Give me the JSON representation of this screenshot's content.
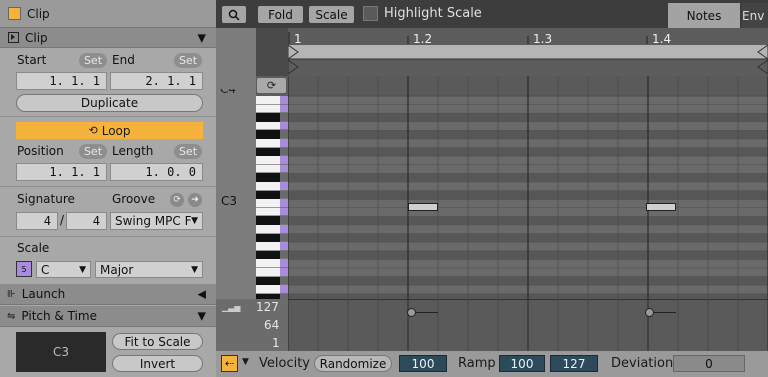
{
  "clip_panel": {
    "header_title": "Clip",
    "section_title": "Clip",
    "start_label": "Start",
    "end_label": "End",
    "set_label": "Set",
    "start_value": "1.   1.   1",
    "end_value": "2.   1.   1",
    "duplicate_label": "Duplicate",
    "loop_label": "Loop",
    "position_label": "Position",
    "length_label": "Length",
    "position_value": "1.   1.   1",
    "length_value": "1.   0.   0",
    "signature_label": "Signature",
    "groove_label": "Groove",
    "sig_numerator": "4",
    "sig_slash": "/",
    "sig_denominator": "4",
    "groove_value": "Swing MPC F",
    "scale_label": "Scale",
    "scale_root": "C",
    "scale_mode": "Major",
    "launch_label": "Launch",
    "pitch_time_label": "Pitch & Time",
    "pitch_display": "C3",
    "fit_to_scale_label": "Fit to Scale",
    "invert_label": "Invert"
  },
  "toolbar": {
    "fold_label": "Fold",
    "scale_label": "Scale",
    "highlight_scale_label": "Highlight Scale",
    "notes_tab": "Notes",
    "env_tab": "Env"
  },
  "ruler": {
    "markers": [
      "1",
      "1.2",
      "1.3",
      "1.4"
    ]
  },
  "piano": {
    "upper_label": "C4",
    "c3_label": "C3"
  },
  "velocity_lane": {
    "tick_127": "127",
    "tick_64": "64",
    "tick_1": "1"
  },
  "bottom_bar": {
    "velocity_label": "Velocity",
    "randomize_label": "Randomize",
    "velocity_value": "100",
    "ramp_label": "Ramp",
    "ramp_start": "100",
    "ramp_end": "127",
    "deviation_label": "Deviation",
    "deviation_value": "0"
  },
  "colors": {
    "accent": "#f5b33c",
    "scale_key": "#a78bdc",
    "value_field": "#2d4a5a"
  }
}
